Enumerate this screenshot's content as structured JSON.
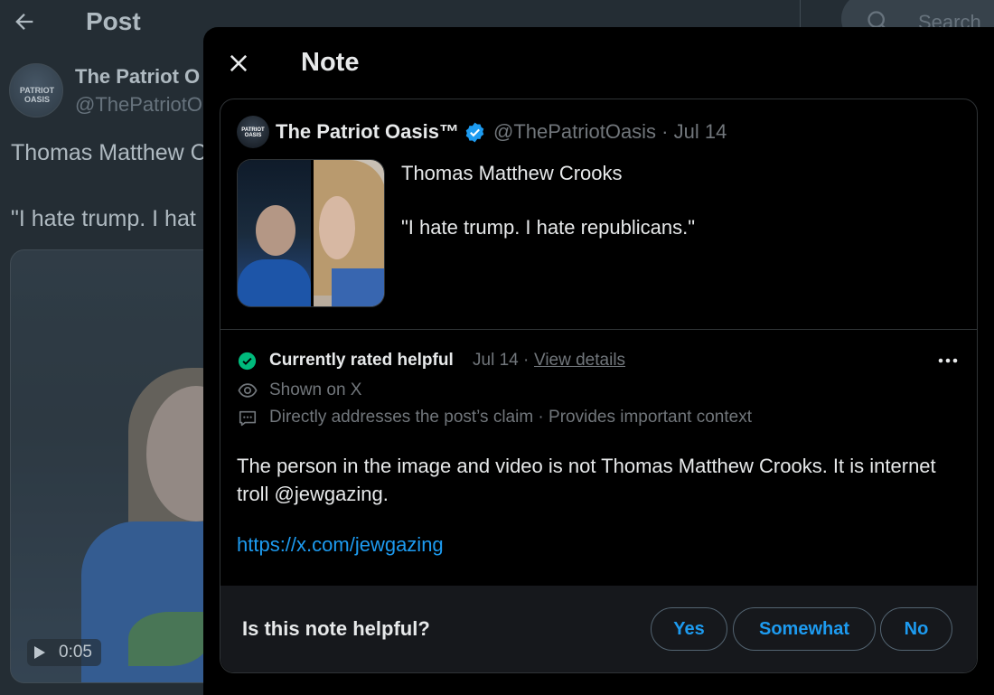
{
  "background": {
    "header_title": "Post",
    "search_placeholder": "Search",
    "author_name": "The Patriot O",
    "author_handle": "@ThePatriotO",
    "avatar_text": "PATRIOT OASIS",
    "text_line1": "Thomas Matthew C",
    "text_line2": "\"I hate trump. I hat",
    "video_time": "0:05"
  },
  "modal": {
    "title": "Note"
  },
  "quoted_post": {
    "author_name": "The Patriot Oasis™",
    "handle_and_date": "@ThePatriotOasis · Jul 14",
    "avatar_text": "PATRIOT OASIS",
    "text_line1": "Thomas Matthew Crooks",
    "text_line2": "\"I hate trump. I hate republicans.\""
  },
  "note": {
    "status_label": "Currently rated helpful",
    "status_date": "Jul 14",
    "separator": "·",
    "view_details": "View details",
    "shown_on": "Shown on X",
    "reasons": "Directly addresses the post’s claim · Provides important context",
    "body": "The person in the image and video is not Thomas Matthew Crooks. It is internet troll @jewgazing.",
    "link": "https://x.com/jewgazing",
    "status_color": "#00ba7c",
    "link_color": "#1d9bf0"
  },
  "rating": {
    "question": "Is this note helpful?",
    "yes": "Yes",
    "somewhat": "Somewhat",
    "no": "No"
  }
}
